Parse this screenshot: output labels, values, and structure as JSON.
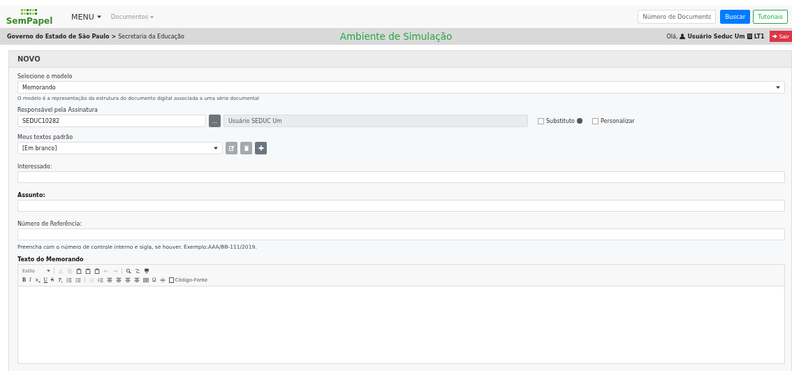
{
  "navbar": {
    "logo": "SemPapel",
    "menu": "MENU",
    "documentos": "Documentos",
    "search": {
      "placeholder": "Número de Documento"
    },
    "search_button": "Buscar",
    "tutorials_button": "Tutoriais"
  },
  "breadcrumb": {
    "parent": "Governo do Estado de São Paulo",
    "separator": ">",
    "current": "Secretaria da Educação",
    "environment": "Ambiente de Simulação",
    "greeting": "Olá,",
    "user": "Usuário Seduc Um",
    "unit": "LT1",
    "logout": "Sair"
  },
  "card": {
    "title": "NOVO"
  },
  "modelo": {
    "label": "Selecione o modelo",
    "value": "Memorando",
    "help": "O modelo é a representação da estrutura do documento digital associada a uma série documental"
  },
  "responsavel": {
    "label": "Responsável pela Assinatura",
    "value": "SEDUC10282",
    "lookup_button": "...",
    "name": "Usuário SEDUC Um",
    "options": [
      {
        "label": "Substituto",
        "checked": false,
        "info": true
      },
      {
        "label": "Personalizar",
        "checked": false
      }
    ]
  },
  "textos": {
    "label": "Meus textos padrão",
    "value": "[Em branco]",
    "actions": [
      {
        "kind": "edit",
        "disabled": true
      },
      {
        "kind": "delete",
        "disabled": true
      },
      {
        "kind": "add",
        "disabled": false
      }
    ]
  },
  "fields": [
    {
      "label": "Interessado:",
      "bold": false
    },
    {
      "label": "Assunto:",
      "bold": true
    },
    {
      "label": "Número de Referência:",
      "bold": false,
      "help": "Preencha com o número de controle interno e sigla, se houver. Exemplo:AAA/BB-111/2019."
    }
  ],
  "editor": {
    "label": "Texto do Memorando",
    "toolbars": [
      [
        {
          "kind": "combo",
          "label": "Estilo"
        },
        {
          "kind": "sep"
        },
        {
          "kind": "cut",
          "disabled": true
        },
        {
          "kind": "copy",
          "disabled": true
        },
        {
          "kind": "paste",
          "disabled": false
        },
        {
          "kind": "paste",
          "disabled": false
        },
        {
          "kind": "paste",
          "disabled": false
        },
        {
          "kind": "undo",
          "disabled": true
        },
        {
          "kind": "redo",
          "disabled": true
        },
        {
          "kind": "sep"
        },
        {
          "kind": "search",
          "disabled": false
        },
        {
          "kind": "replace",
          "disabled": false
        },
        {
          "kind": "page",
          "disabled": false
        }
      ],
      [
        {
          "kind": "bold",
          "label": "B"
        },
        {
          "kind": "italic",
          "label": "I"
        },
        {
          "kind": "sub",
          "disabled": false
        },
        {
          "kind": "underline",
          "label": "U"
        },
        {
          "kind": "strike",
          "label": "S"
        },
        {
          "kind": "clear",
          "disabled": false
        },
        {
          "kind": "list",
          "disabled": false
        },
        {
          "kind": "list",
          "disabled": false
        },
        {
          "kind": "sep"
        },
        {
          "kind": "outdent",
          "disabled": true
        },
        {
          "kind": "indent",
          "disabled": false
        },
        {
          "kind": "align",
          "disabled": false
        },
        {
          "kind": "align",
          "disabled": false
        },
        {
          "kind": "align",
          "disabled": false
        },
        {
          "kind": "align",
          "disabled": false
        },
        {
          "kind": "table",
          "disabled": false
        },
        {
          "kind": "symbol",
          "label": "Ω"
        },
        {
          "kind": "rule",
          "disabled": false
        },
        {
          "kind": "source",
          "label": "Código-Fonte"
        }
      ]
    ]
  }
}
